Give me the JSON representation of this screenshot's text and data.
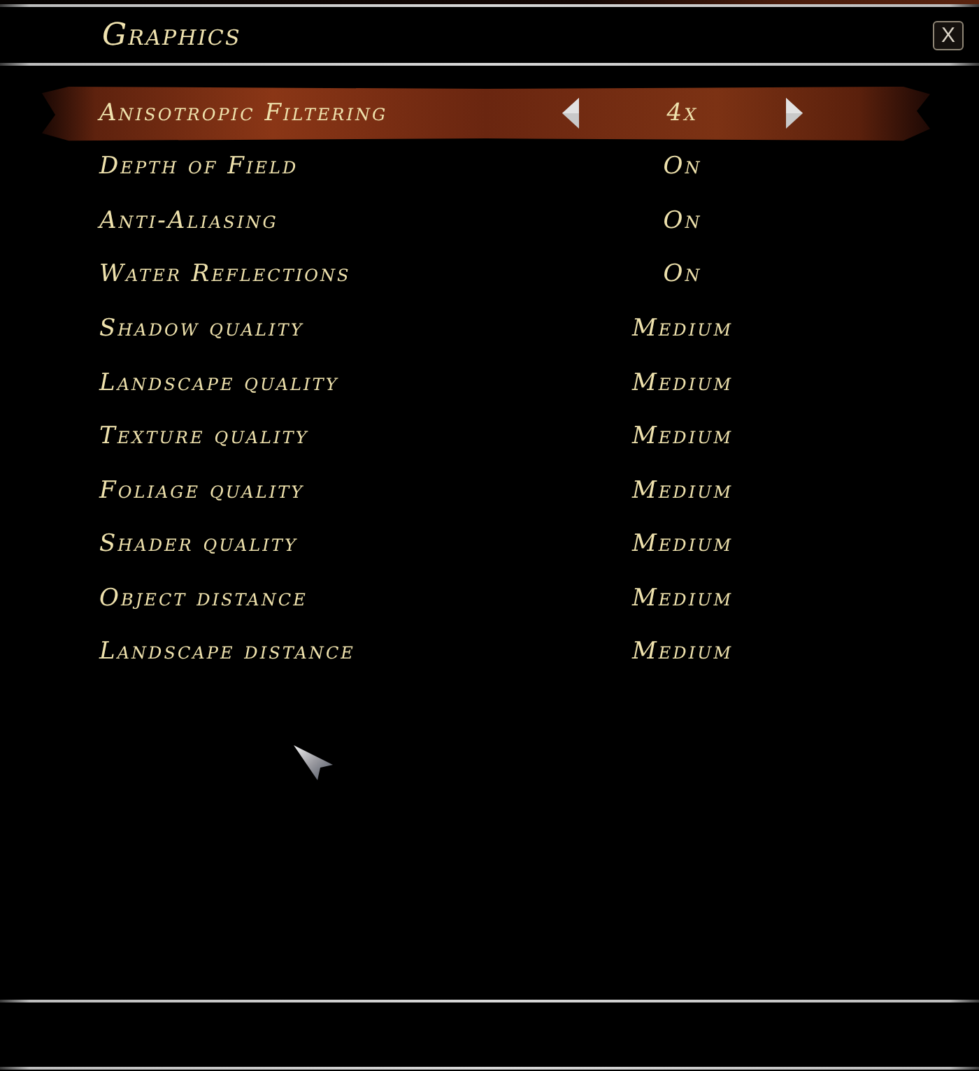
{
  "window": {
    "title": "Graphics",
    "close_label": "X"
  },
  "settings": [
    {
      "label": "Anisotropic Filtering",
      "value": "4x",
      "selected": true
    },
    {
      "label": "Depth of Field",
      "value": "On",
      "selected": false
    },
    {
      "label": "Anti-Aliasing",
      "value": "On",
      "selected": false
    },
    {
      "label": "Water Reflections",
      "value": "On",
      "selected": false
    },
    {
      "label": "Shadow quality",
      "value": "Medium",
      "selected": false
    },
    {
      "label": "Landscape quality",
      "value": "Medium",
      "selected": false
    },
    {
      "label": "Texture quality",
      "value": "Medium",
      "selected": false
    },
    {
      "label": "Foliage quality",
      "value": "Medium",
      "selected": false
    },
    {
      "label": "Shader quality",
      "value": "Medium",
      "selected": false
    },
    {
      "label": "Object distance",
      "value": "Medium",
      "selected": false
    },
    {
      "label": "Landscape distance",
      "value": "Medium",
      "selected": false
    }
  ]
}
